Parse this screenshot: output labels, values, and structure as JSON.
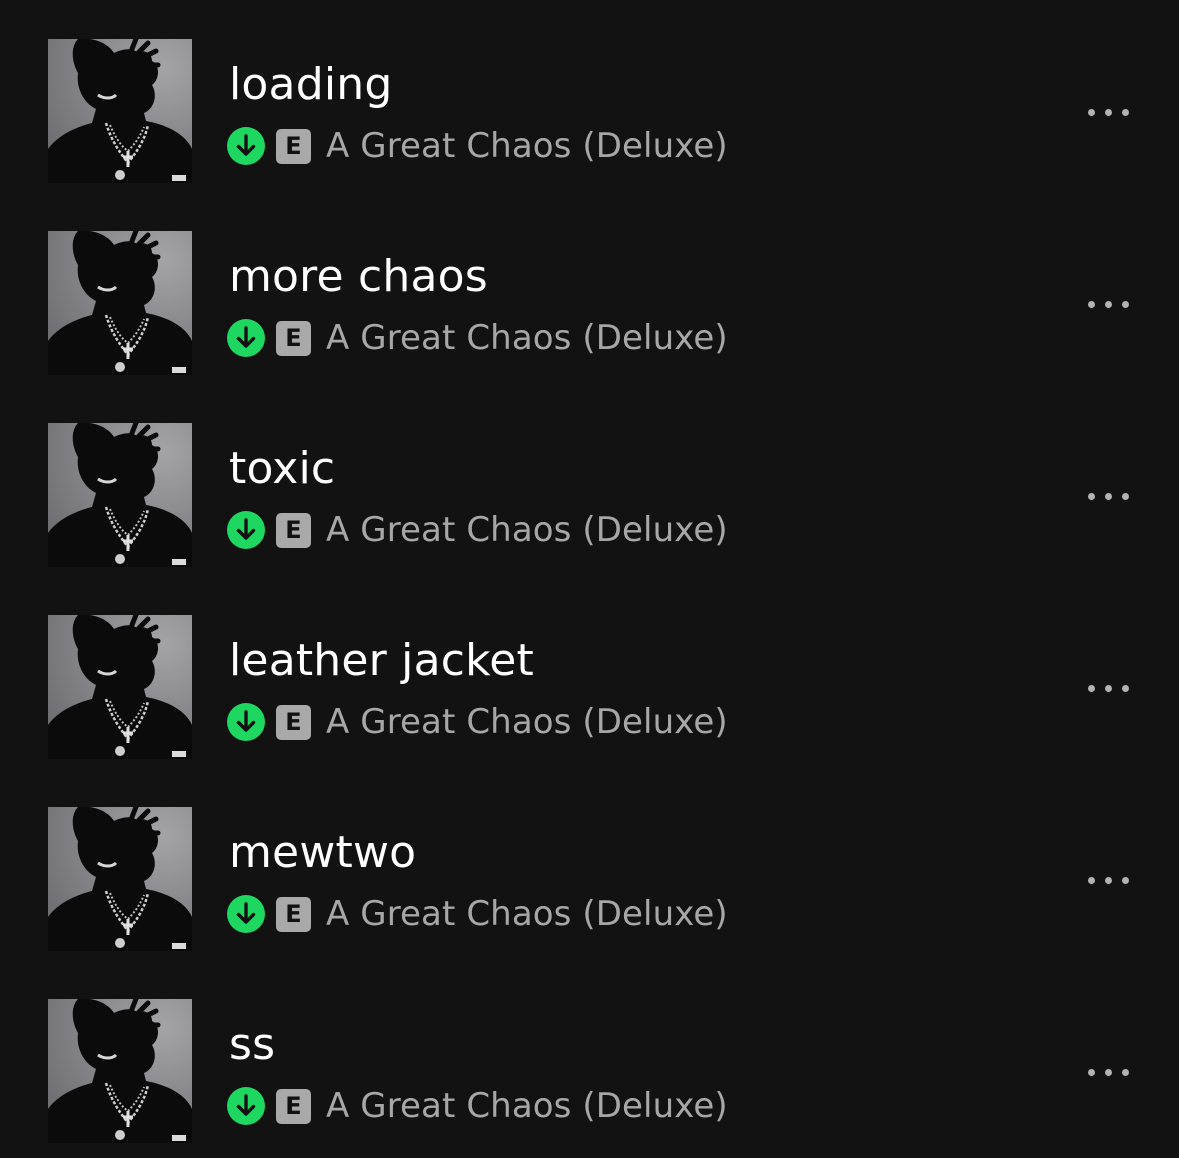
{
  "colors": {
    "background": "#121212",
    "title": "#ffffff",
    "subtitle": "#a7a7a7",
    "download_green": "#1ed760",
    "explicit_badge": "#a9a9a9"
  },
  "tracks": [
    {
      "title": "loading",
      "explicit": "E",
      "album": "A Great Chaos (Deluxe)",
      "downloaded_icon": "download-icon",
      "more_icon": "more-options-icon"
    },
    {
      "title": "more chaos",
      "explicit": "E",
      "album": "A Great Chaos (Deluxe)",
      "downloaded_icon": "download-icon",
      "more_icon": "more-options-icon"
    },
    {
      "title": "toxic",
      "explicit": "E",
      "album": "A Great Chaos (Deluxe)",
      "downloaded_icon": "download-icon",
      "more_icon": "more-options-icon"
    },
    {
      "title": "leather jacket",
      "explicit": "E",
      "album": "A Great Chaos (Deluxe)",
      "downloaded_icon": "download-icon",
      "more_icon": "more-options-icon"
    },
    {
      "title": "mewtwo",
      "explicit": "E",
      "album": "A Great Chaos (Deluxe)",
      "downloaded_icon": "download-icon",
      "more_icon": "more-options-icon"
    },
    {
      "title": "ss",
      "explicit": "E",
      "album": "A Great Chaos (Deluxe)",
      "downloaded_icon": "download-icon",
      "more_icon": "more-options-icon"
    }
  ]
}
